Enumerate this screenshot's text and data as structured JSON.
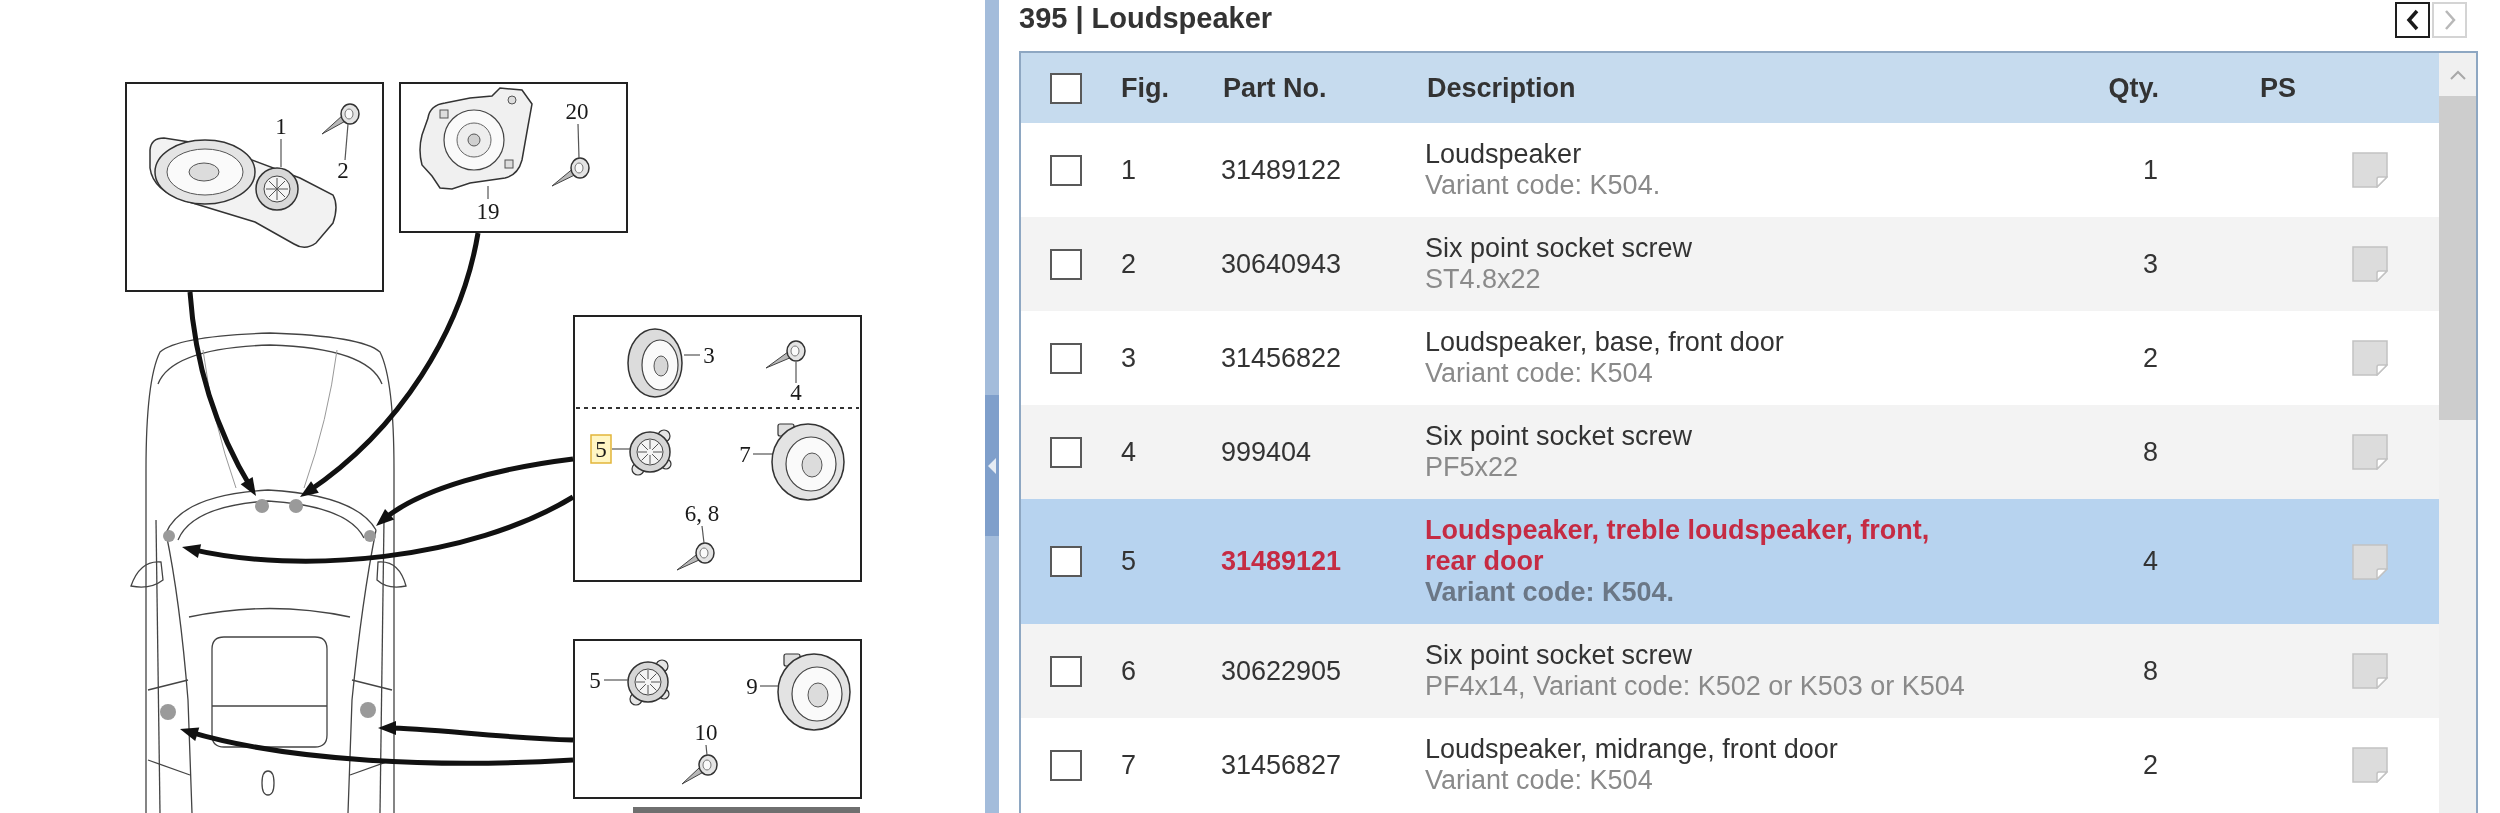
{
  "diagram": {
    "callouts": [
      {
        "label": "1",
        "highlighted": false
      },
      {
        "label": "2",
        "highlighted": false
      },
      {
        "label": "20",
        "highlighted": false
      },
      {
        "label": "19",
        "highlighted": false
      },
      {
        "label": "3",
        "highlighted": false
      },
      {
        "label": "4",
        "highlighted": false
      },
      {
        "label": "5",
        "highlighted": true
      },
      {
        "label": "7",
        "highlighted": false
      },
      {
        "label": "6, 8",
        "highlighted": false
      },
      {
        "label": "5",
        "highlighted": false
      },
      {
        "label": "9",
        "highlighted": false
      },
      {
        "label": "10",
        "highlighted": false
      }
    ]
  },
  "panel": {
    "title": "395 | Loudspeaker",
    "pager": [
      {
        "kind": "previous",
        "disabled": false
      },
      {
        "kind": "next",
        "disabled": true
      }
    ]
  },
  "table": {
    "select_all_checked": false,
    "columns": [
      "Fig.",
      "Part No.",
      "Description",
      "Qty.",
      "PS"
    ],
    "rows": [
      {
        "checked": false,
        "selected": false,
        "fig": "1",
        "part_no": "31489122",
        "description": "Loudspeaker",
        "detail": "Variant code: K504.",
        "qty": "1"
      },
      {
        "checked": false,
        "selected": false,
        "fig": "2",
        "part_no": "30640943",
        "description": "Six point socket screw",
        "detail": "ST4.8x22",
        "qty": "3"
      },
      {
        "checked": false,
        "selected": false,
        "fig": "3",
        "part_no": "31456822",
        "description": "Loudspeaker, base, front door",
        "detail": "Variant code: K504",
        "qty": "2"
      },
      {
        "checked": false,
        "selected": false,
        "fig": "4",
        "part_no": "999404",
        "description": "Six point socket screw",
        "detail": "PF5x22",
        "qty": "8"
      },
      {
        "checked": false,
        "selected": true,
        "fig": "5",
        "part_no": "31489121",
        "description": "Loudspeaker, treble loudspeaker, front, rear door",
        "detail": "Variant code: K504.",
        "qty": "4"
      },
      {
        "checked": false,
        "selected": false,
        "fig": "6",
        "part_no": "30622905",
        "description": "Six point socket screw",
        "detail": "PF4x14, Variant code: K502 or K503 or K504",
        "qty": "8"
      },
      {
        "checked": false,
        "selected": false,
        "fig": "7",
        "part_no": "31456827",
        "description": "Loudspeaker, midrange, front door",
        "detail": "Variant code: K504",
        "qty": "2"
      }
    ]
  }
}
